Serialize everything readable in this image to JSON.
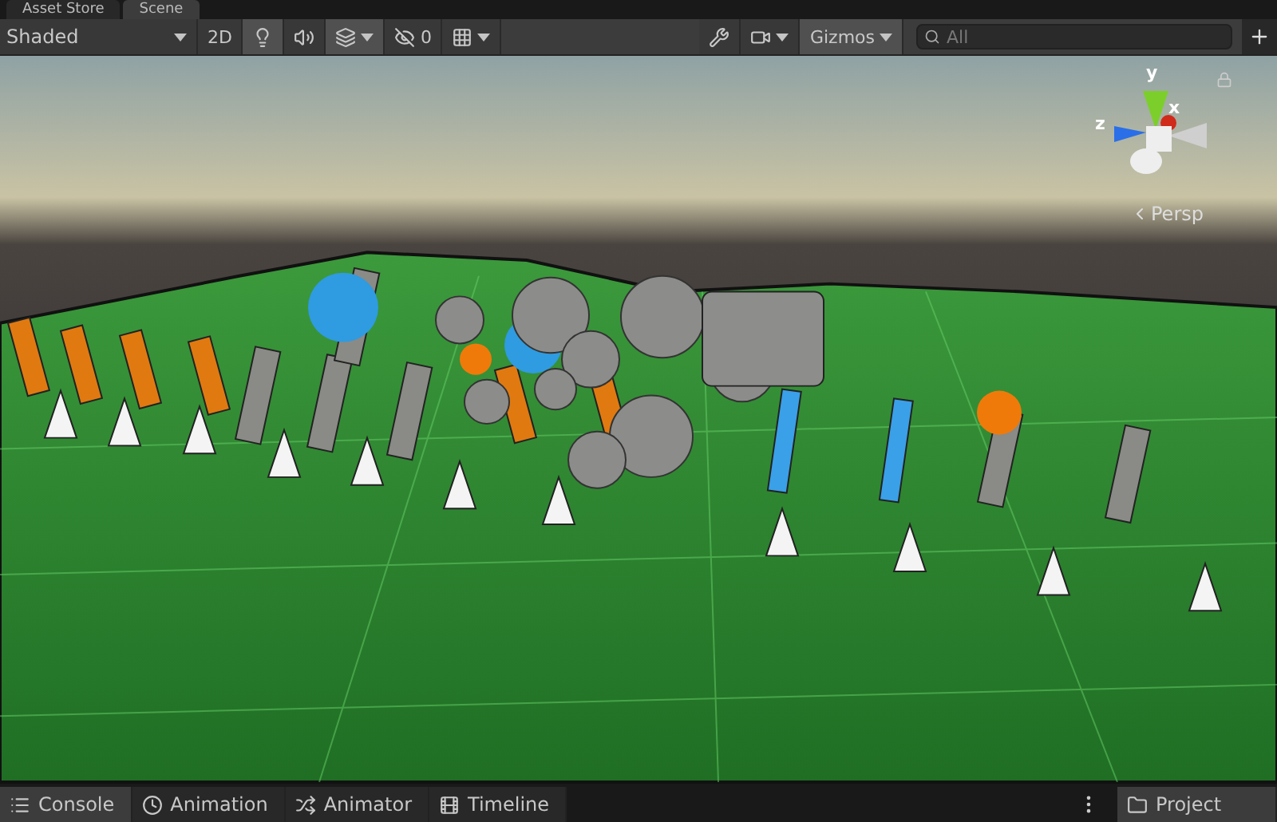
{
  "top_tabs": [
    {
      "label": "Asset Store",
      "selected": false
    },
    {
      "label": "Scene",
      "selected": true
    }
  ],
  "toolbar": {
    "shading_mode": "Shaded",
    "mode_2d": {
      "label": "2D",
      "on": false
    },
    "lighting": {
      "on": true
    },
    "audio": {
      "on": false
    },
    "effects": {
      "on": true
    },
    "hidden_count": "0",
    "grid": {
      "on": false
    },
    "gizmos": {
      "label": "Gizmos",
      "on": true
    },
    "search": {
      "placeholder": "All"
    }
  },
  "gizmo": {
    "axes": [
      {
        "label": "y"
      },
      {
        "label": "x"
      },
      {
        "label": "z"
      }
    ],
    "projection": "Persp"
  },
  "bottom_tabs": [
    {
      "label": "Console",
      "kind": "console",
      "selected": true
    },
    {
      "label": "Animation",
      "kind": "animation",
      "selected": false
    },
    {
      "label": "Animator",
      "kind": "animator",
      "selected": false
    },
    {
      "label": "Timeline",
      "kind": "timeline",
      "selected": false
    }
  ],
  "side_tab": {
    "label": "Project",
    "selected": true
  }
}
